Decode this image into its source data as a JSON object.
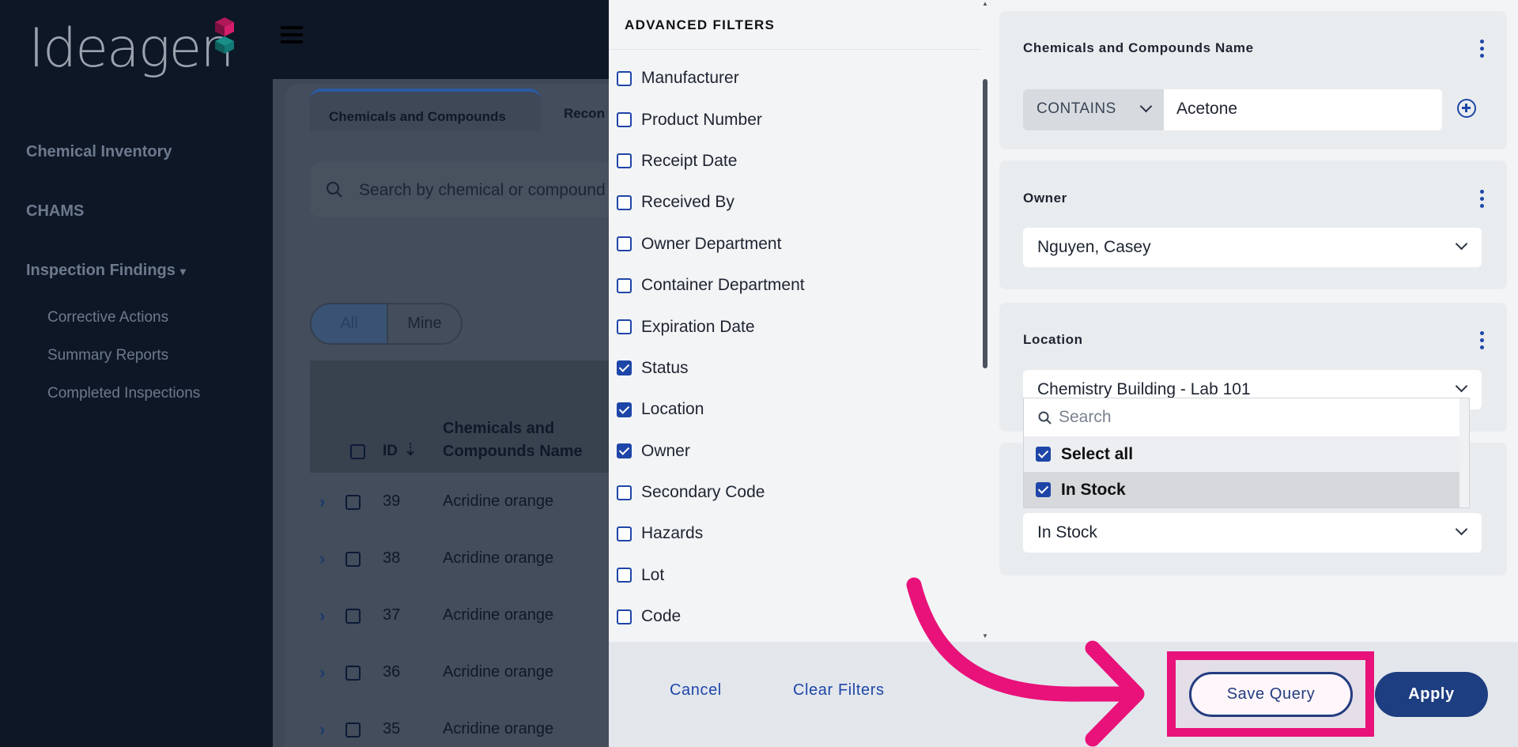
{
  "sidebar": {
    "logo": "Ideagen",
    "items": [
      {
        "label": "Chemical Inventory"
      },
      {
        "label": "CHAMS"
      },
      {
        "label": "Inspection Findings",
        "caret": "▾"
      }
    ],
    "subitems": [
      {
        "label": "Corrective Actions"
      },
      {
        "label": "Summary Reports"
      },
      {
        "label": "Completed Inspections"
      }
    ]
  },
  "main": {
    "tabs": [
      {
        "label": "Chemicals and Compounds",
        "active": true
      },
      {
        "label": "Recon"
      }
    ],
    "search_placeholder": "Search by chemical or compound",
    "toggle": {
      "all": "All",
      "mine": "Mine"
    },
    "table": {
      "headers": {
        "id": "ID",
        "name_line1": "Chemicals and",
        "name_line2": "Compounds Name"
      },
      "rows": [
        {
          "id": "39",
          "name": "Acridine orange"
        },
        {
          "id": "38",
          "name": "Acridine orange"
        },
        {
          "id": "37",
          "name": "Acridine orange"
        },
        {
          "id": "36",
          "name": "Acridine orange"
        },
        {
          "id": "35",
          "name": "Acridine orange"
        }
      ]
    }
  },
  "advanced_filters": {
    "title": "ADVANCED FILTERS",
    "fields": [
      {
        "label": "Manufacturer",
        "checked": false
      },
      {
        "label": "Product Number",
        "checked": false
      },
      {
        "label": "Receipt Date",
        "checked": false
      },
      {
        "label": "Received By",
        "checked": false
      },
      {
        "label": "Owner Department",
        "checked": false
      },
      {
        "label": "Container Department",
        "checked": false
      },
      {
        "label": "Expiration Date",
        "checked": false
      },
      {
        "label": "Status",
        "checked": true
      },
      {
        "label": "Location",
        "checked": true
      },
      {
        "label": "Owner",
        "checked": true
      },
      {
        "label": "Secondary Code",
        "checked": false
      },
      {
        "label": "Hazards",
        "checked": false
      },
      {
        "label": "Lot",
        "checked": false
      },
      {
        "label": "Code",
        "checked": false
      }
    ],
    "filters": {
      "name": {
        "title": "Chemicals and Compounds Name",
        "operator": "CONTAINS",
        "value": "Acetone"
      },
      "owner": {
        "title": "Owner",
        "value": "Nguyen, Casey"
      },
      "location": {
        "title": "Location",
        "value": "Chemistry Building - Lab 101"
      },
      "status": {
        "value": "In Stock"
      }
    },
    "dropdown": {
      "search_placeholder": "Search",
      "options": [
        {
          "label": "Select all",
          "checked": true
        },
        {
          "label": "In Stock",
          "checked": true
        }
      ]
    },
    "footer": {
      "cancel": "Cancel",
      "clear": "Clear Filters",
      "save": "Save Query",
      "apply": "Apply"
    }
  },
  "colors": {
    "accent": "#1e46a8",
    "primary_button": "#1d3e80",
    "highlight": "#e8127a"
  }
}
